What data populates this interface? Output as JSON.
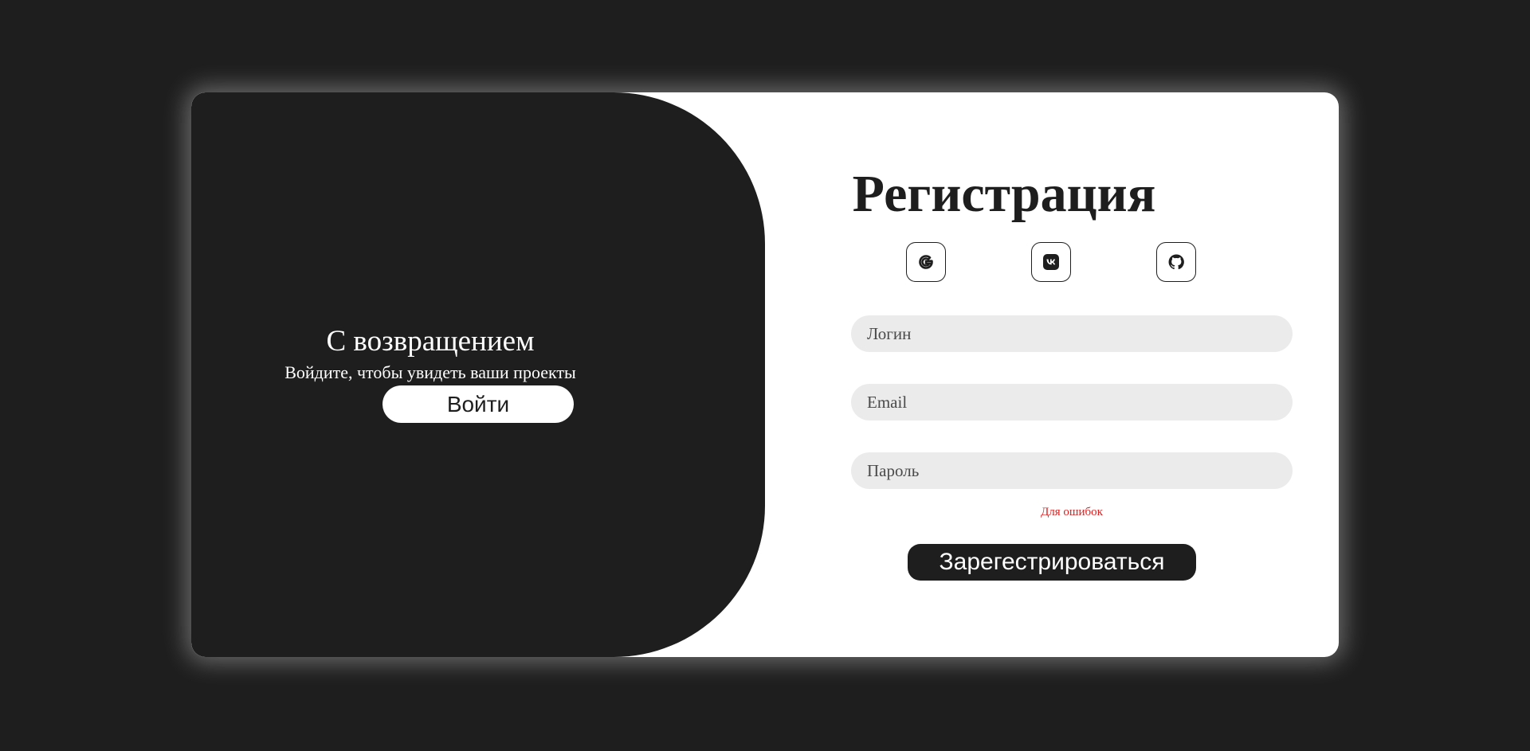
{
  "welcome": {
    "title": "С возвращением",
    "subtitle": "Войдите, чтобы увидеть ваши проекты",
    "login_button": "Войти"
  },
  "register": {
    "title": "Регистрация",
    "social": [
      {
        "name": "google",
        "icon": "google-icon"
      },
      {
        "name": "vk",
        "icon": "vk-icon"
      },
      {
        "name": "github",
        "icon": "github-icon"
      }
    ],
    "fields": {
      "login_placeholder": "Логин",
      "email_placeholder": "Email",
      "password_placeholder": "Пароль"
    },
    "error_text": "Для ошибок",
    "submit_button": "Зарегестрироваться"
  },
  "colors": {
    "background": "#1e1e1e",
    "card": "#ffffff",
    "input_bg": "#ebebeb",
    "error": "#e02020"
  }
}
